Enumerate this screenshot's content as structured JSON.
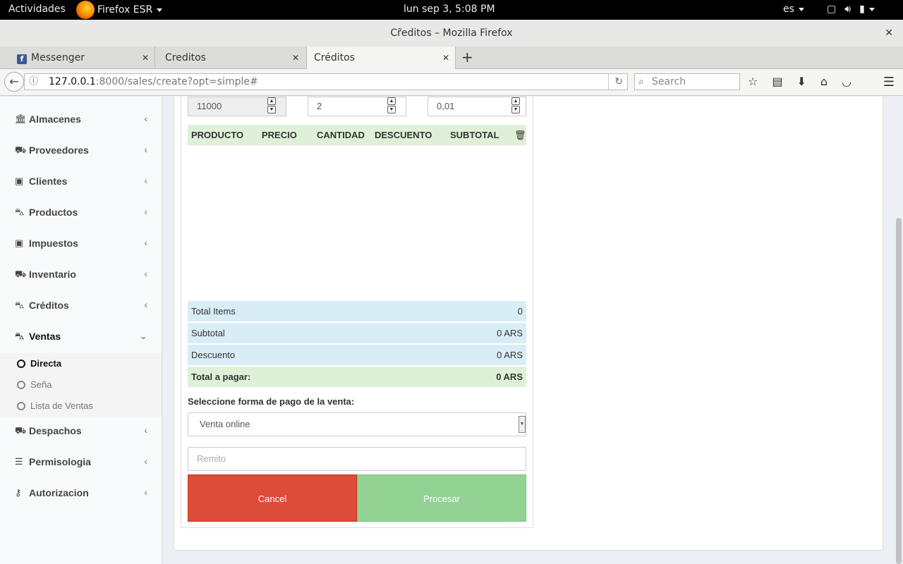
{
  "topbar": {
    "activities": "Actividades",
    "app_name": "Firefox ESR",
    "clock": "lun sep  3,  5:08 PM",
    "lang": "es"
  },
  "window": {
    "title": "Cr̃editos – Mozilla Firefox",
    "close": "✕"
  },
  "tabs": [
    {
      "label": "Messenger",
      "icon": "facebook-icon"
    },
    {
      "label": "Creditos"
    },
    {
      "label": "Créditos",
      "active": true
    }
  ],
  "navbar": {
    "url_host": "127.0.0.1",
    "url_rest": ":8000/sales/create?opt=simple#",
    "search_placeholder": "Search"
  },
  "sidebar": {
    "items": [
      {
        "label": "Almacenes",
        "icon": "bank-icon"
      },
      {
        "label": "Proveedores",
        "icon": "truck-icon"
      },
      {
        "label": "Clientes",
        "icon": "briefcase-icon"
      },
      {
        "label": "Productos",
        "icon": "cart-icon"
      },
      {
        "label": "Impuestos",
        "icon": "briefcase-icon"
      },
      {
        "label": "Inventario",
        "icon": "truck-icon"
      },
      {
        "label": "Créditos",
        "icon": "cart-icon"
      },
      {
        "label": "Ventas",
        "icon": "cart-icon",
        "expanded": true
      },
      {
        "label": "Despachos",
        "icon": "truck-icon"
      },
      {
        "label": "Permisologia",
        "icon": "list-icon"
      },
      {
        "label": "Autorizacion",
        "icon": "key-icon"
      }
    ],
    "subitems": [
      {
        "label": "Directa",
        "active": true
      },
      {
        "label": "Seña"
      },
      {
        "label": "Lista de Ventas"
      }
    ]
  },
  "form": {
    "price_value": "11000",
    "quantity_value": "2",
    "discount_value": "0,01"
  },
  "table": {
    "headers": [
      "PRODUCTO",
      "PRECIO",
      "CANTIDAD",
      "DESCUENTO",
      "SUBTOTAL"
    ]
  },
  "summary": {
    "total_items_label": "Total Items",
    "total_items_value": "0",
    "subtotal_label": "Subtotal",
    "subtotal_value": "0 ARS",
    "discount_label": "Descuento",
    "discount_value": "0 ARS",
    "total_label": "Total a pagar:",
    "total_value": "0 ARS"
  },
  "payment": {
    "label": "Seleccione forma de pago de la venta:",
    "selected": "Venta online",
    "remito_placeholder": "Remito"
  },
  "buttons": {
    "cancel": "Cancel",
    "process": "Procesar"
  },
  "colors": {
    "cancel": "#dd4b39",
    "process": "#92d293",
    "table_header": "#dff0d8",
    "summary": "#d9edf7"
  }
}
